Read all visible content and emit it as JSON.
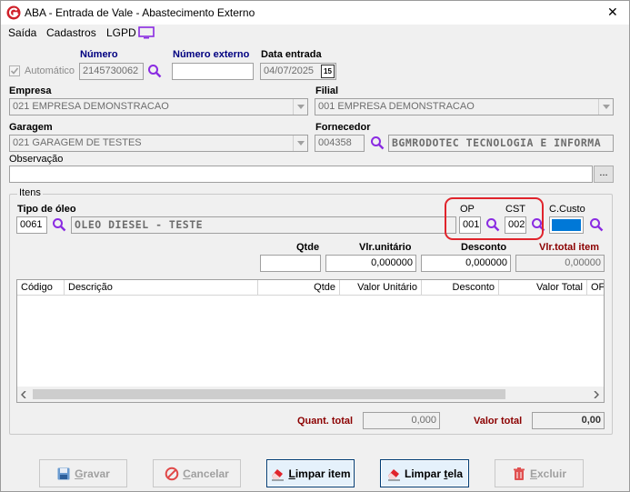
{
  "window": {
    "title": "ABA - Entrada de Vale - Abastecimento Externo",
    "close_glyph": "✕"
  },
  "menu": {
    "items": [
      "Saída",
      "Cadastros",
      "LGPD"
    ]
  },
  "header": {
    "automatico_label": "Automático",
    "numero_label": "Número",
    "numero_value": "2145730062",
    "numero_externo_label": "Número externo",
    "numero_externo_value": "",
    "data_entrada_label": "Data entrada",
    "data_entrada_value": "04/07/2025",
    "calendar_glyph": "15"
  },
  "empresa": {
    "label": "Empresa",
    "value": "021 EMPRESA DEMONSTRACAO"
  },
  "filial": {
    "label": "Filial",
    "value": "001 EMPRESA DEMONSTRACAO"
  },
  "garagem": {
    "label": "Garagem",
    "value": "021 GARAGEM DE TESTES"
  },
  "fornecedor": {
    "label": "Fornecedor",
    "code": "004358",
    "name": "BGMRODOTEC TECNOLOGIA E INFORMA"
  },
  "observacao": {
    "label": "Observação",
    "value": "",
    "button_label": "..."
  },
  "itens": {
    "group_label": "Itens",
    "tipo_oleo_label": "Tipo de óleo",
    "tipo_oleo_code": "0061",
    "tipo_oleo_name": "OLEO DIESEL - TESTE",
    "op_label": "OP",
    "op_value": "001",
    "cst_label": "CST",
    "cst_value": "002",
    "ccusto_label": "C.Custo",
    "ccusto_color": "#0078d7",
    "qtde_label": "Qtde",
    "qtde_value": "",
    "vlr_unitario_label": "Vlr.unitário",
    "vlr_unitario_value": "0,000000",
    "desconto_label": "Desconto",
    "desconto_value": "0,000000",
    "vlr_total_item_label": "Vlr.total item",
    "vlr_total_item_value": "0,00000",
    "grid_columns": [
      "Código",
      "Descrição",
      "Qtde",
      "Valor Unitário",
      "Desconto",
      "Valor Total",
      "OF"
    ],
    "quant_total_label": "Quant. total",
    "quant_total_value": "0,000",
    "valor_total_label": "Valor total",
    "valor_total_value": "0,00"
  },
  "buttons": {
    "gravar": {
      "prefix": "",
      "underline": "G",
      "rest": "ravar"
    },
    "cancelar": {
      "prefix": "",
      "underline": "C",
      "rest": "ancelar"
    },
    "limpar_item": {
      "prefix": "",
      "underline": "L",
      "rest": "impar item"
    },
    "limpar_tela": {
      "prefix": "Limpar ",
      "underline": "t",
      "rest": "ela"
    },
    "excluir": {
      "prefix": "",
      "underline": "E",
      "rest": "xcluir"
    }
  },
  "colors": {
    "accent_red": "#e0242c",
    "label_navy": "#000080",
    "label_darkred": "#8b0000",
    "lookup_purple": "#8a2be2"
  }
}
